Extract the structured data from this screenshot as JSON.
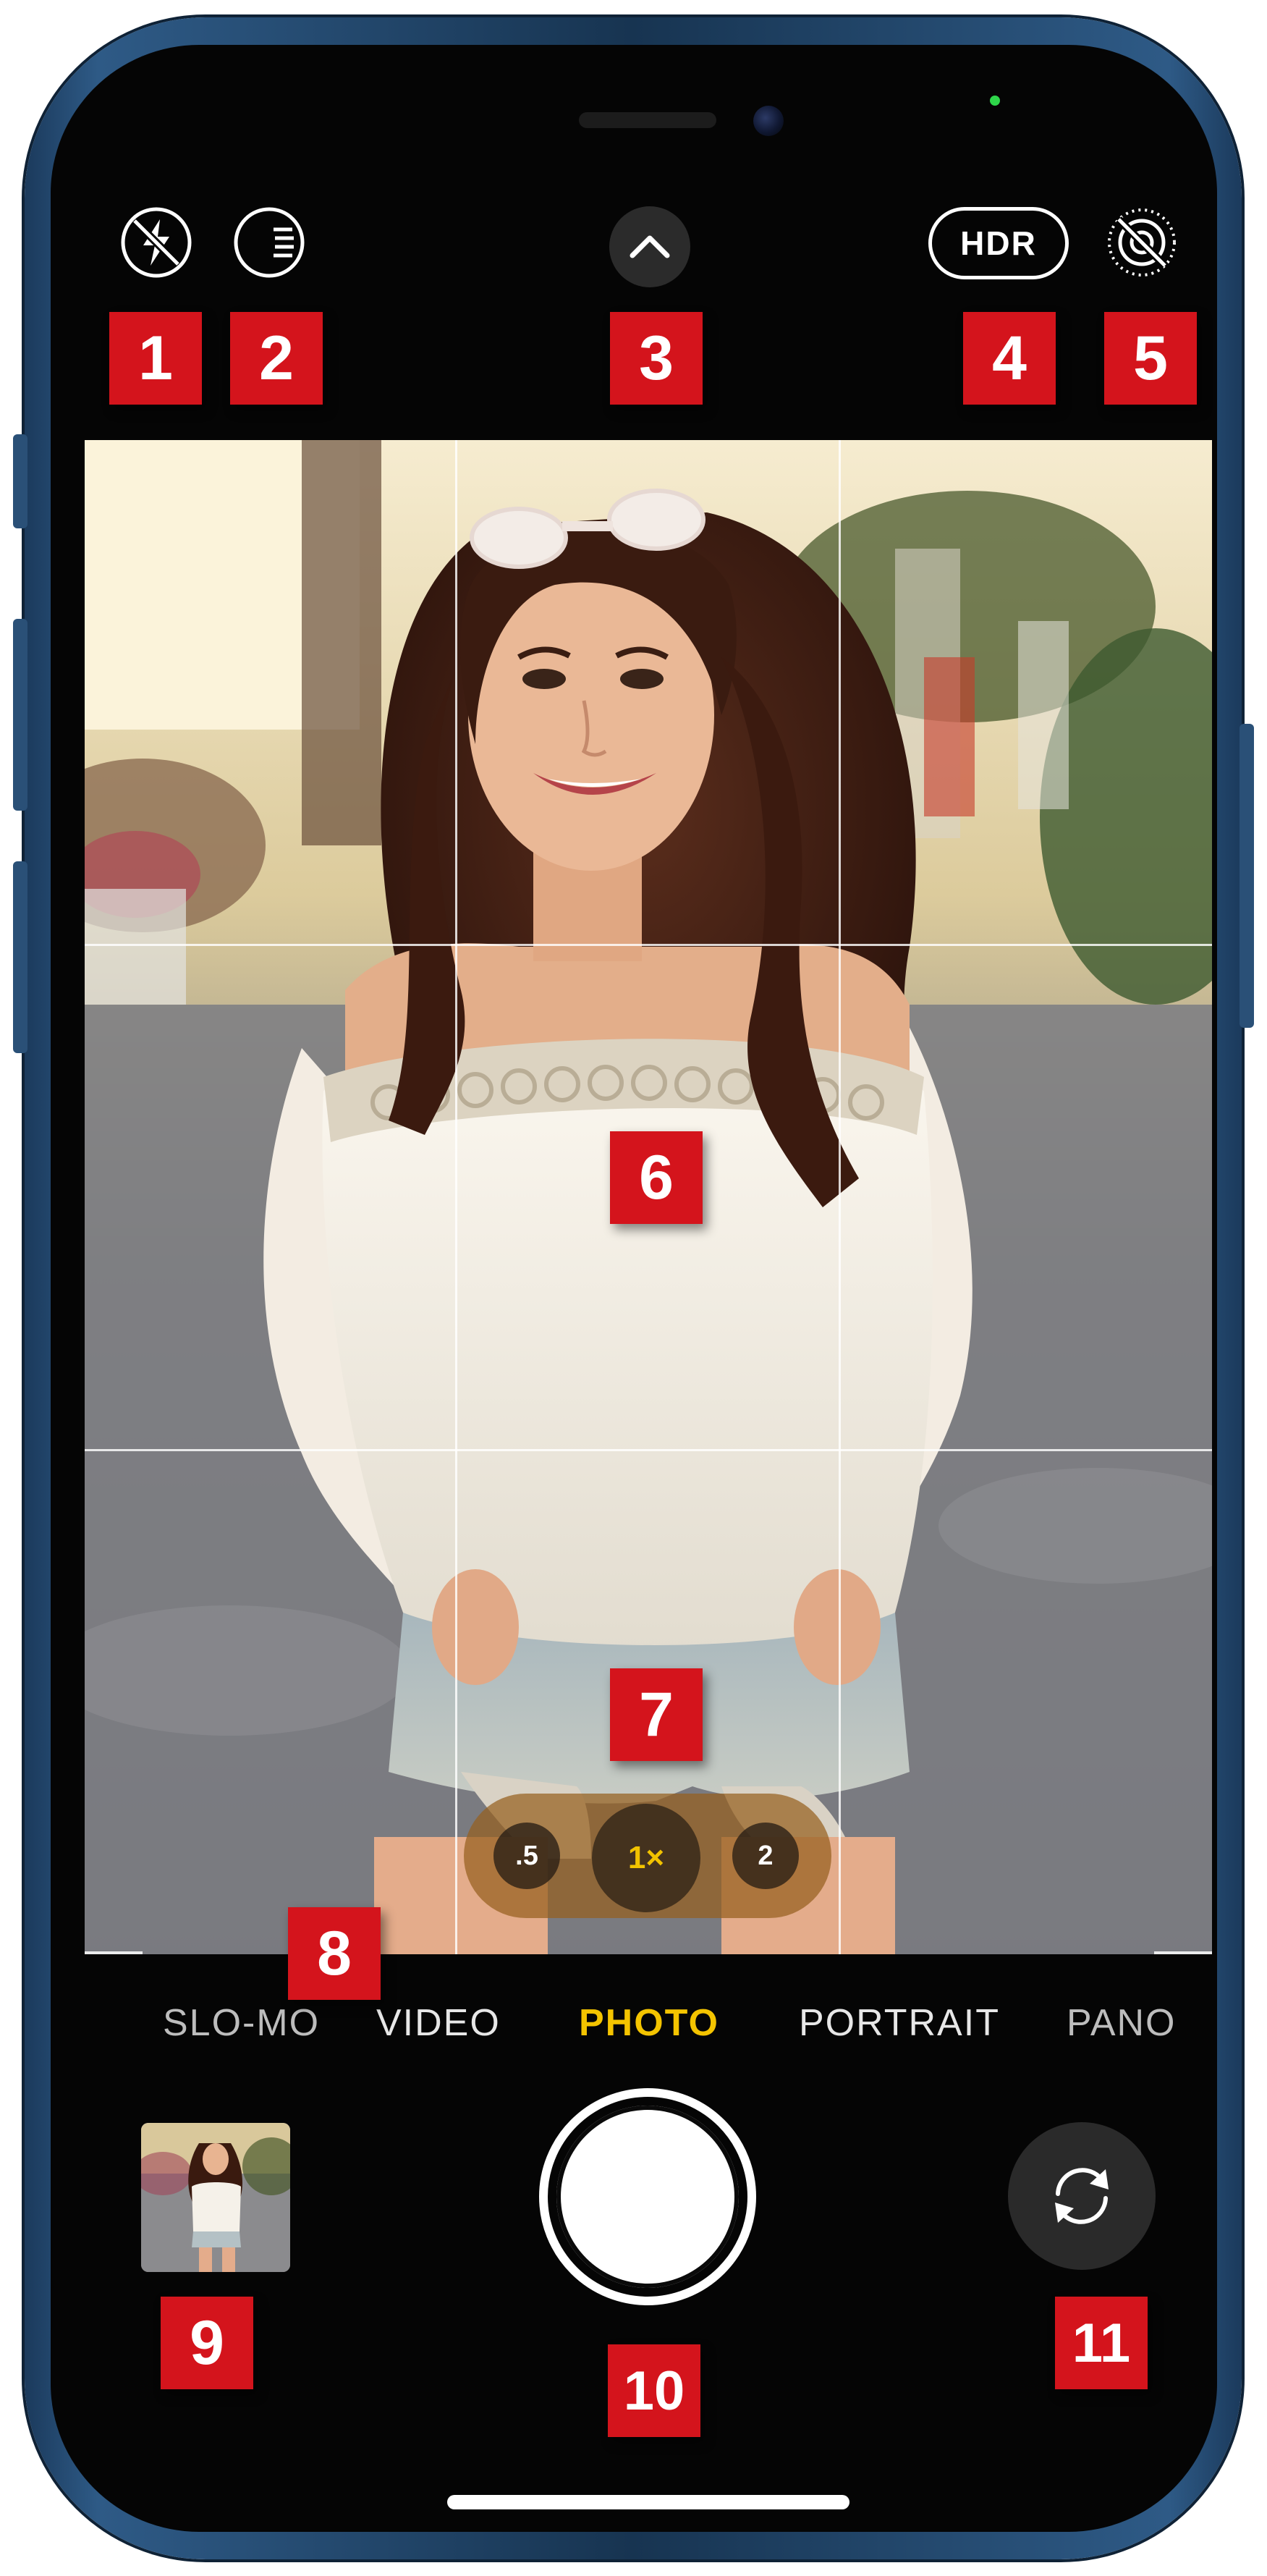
{
  "camera": {
    "top_bar": {
      "flash_icon": "flash-off-icon",
      "night_mode_icon": "night-mode-icon",
      "more_controls_icon": "chevron-up-icon",
      "hdr_label": "HDR",
      "live_photo_icon": "live-photo-off-icon"
    },
    "zoom": {
      "options": [
        ".5",
        "1×",
        "2"
      ],
      "selected": "1×",
      "selected_color": "#f2c300"
    },
    "modes": {
      "items": [
        "SLO-MO",
        "VIDEO",
        "PHOTO",
        "PORTRAIT",
        "PANO"
      ],
      "active": "PHOTO",
      "active_color": "#f4c400"
    },
    "bottom_bar": {
      "thumbnail_icon": "last-photo-thumbnail",
      "shutter_icon": "shutter-button",
      "flip_icon": "flip-camera-icon"
    }
  },
  "callouts": [
    "1",
    "2",
    "3",
    "4",
    "5",
    "6",
    "7",
    "8",
    "9",
    "10",
    "11"
  ],
  "colors": {
    "callout_red": "#d4141c",
    "phone_frame_blue": "#1b3a5c",
    "screen_black": "#050505"
  }
}
